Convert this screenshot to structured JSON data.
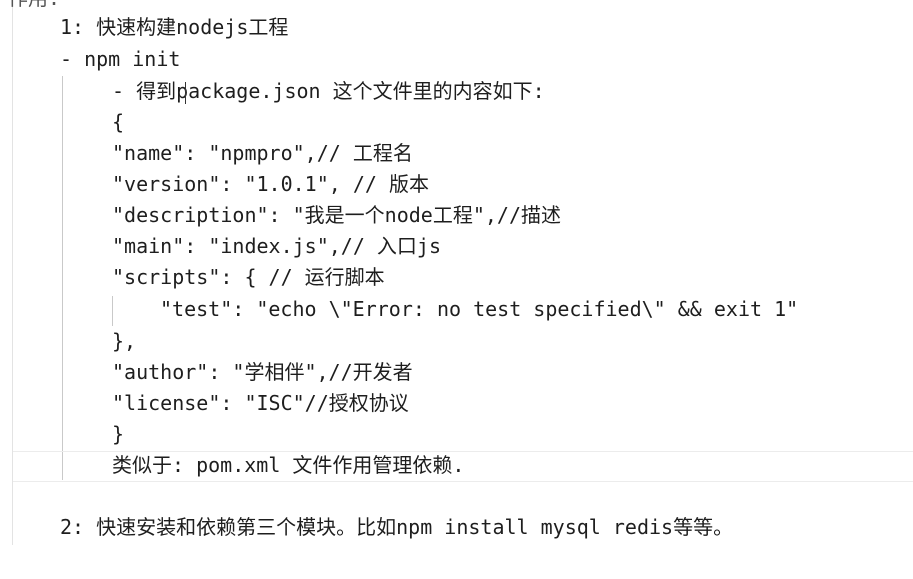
{
  "top_fragment": "作用:",
  "lines": [
    "1: 快速构建nodejs工程",
    "- npm init",
    "- 得到package.json 这个文件里的内容如下:",
    "{",
    "\"name\": \"npmpro\",// 工程名",
    "\"version\": \"1.0.1\", // 版本",
    "\"description\": \"我是一个node工程\",//描述",
    "\"main\": \"index.js\",// 入口js",
    "\"scripts\": { // 运行脚本",
    "\"test\": \"echo \\\"Error: no test specified\\\" && exit 1\"",
    "},",
    "\"author\": \"学相伴\",//开发者",
    "\"license\": \"ISC\"//授权协议",
    "}",
    "类似于: pom.xml 文件作用管理依赖.",
    "2: 快速安装和依赖第三个模块。比如npm install mysql redis等等。"
  ]
}
